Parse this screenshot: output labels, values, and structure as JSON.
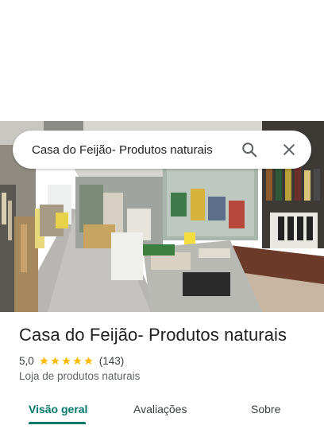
{
  "search": {
    "query": "Casa do Feijão- Produtos naturais",
    "search_icon": "search-icon",
    "close_icon": "close-icon"
  },
  "place": {
    "title": "Casa do Feijão- Produtos naturais",
    "rating": "5,0",
    "stars": 5,
    "review_count": "(143)",
    "category": "Loja de produtos naturais"
  },
  "tabs": [
    {
      "label": "Visão geral",
      "active": true
    },
    {
      "label": "Avaliações",
      "active": false
    },
    {
      "label": "Sobre",
      "active": false
    }
  ],
  "colors": {
    "accent": "#00796b",
    "star": "#fbbc04",
    "text_primary": "#202124",
    "text_secondary": "#5f6368"
  }
}
